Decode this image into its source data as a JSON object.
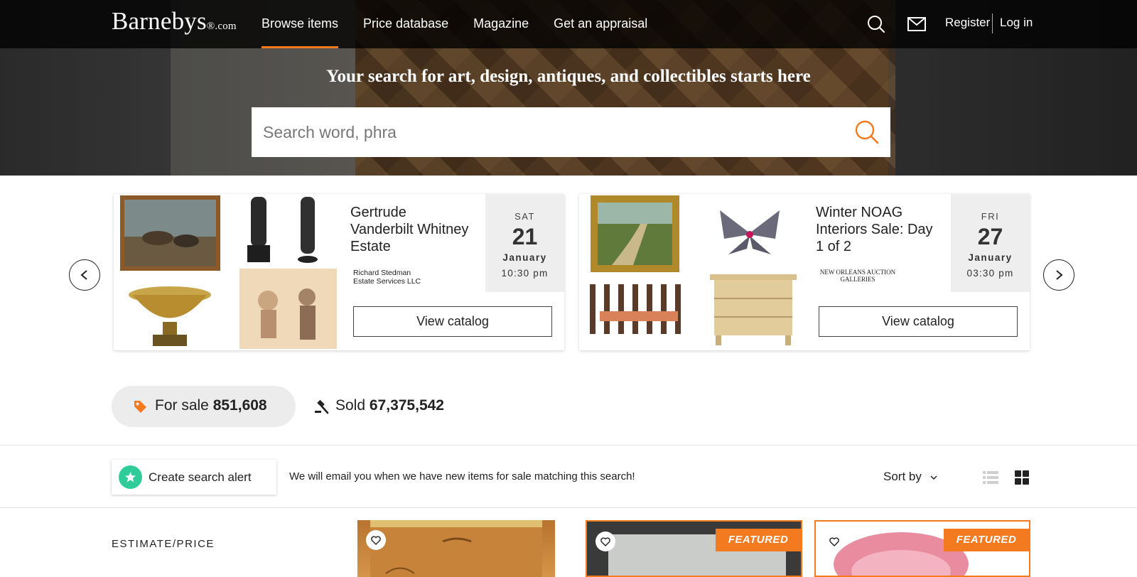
{
  "header": {
    "logo": "Barnebys",
    "logo_suffix": "®.com",
    "nav": [
      {
        "label": "Browse items",
        "active": true
      },
      {
        "label": "Price database",
        "active": false
      },
      {
        "label": "Magazine",
        "active": false
      },
      {
        "label": "Get an appraisal",
        "active": false
      }
    ],
    "icons": [
      "search-icon",
      "mail-icon"
    ],
    "register_label": "Register",
    "login_label": "Log in"
  },
  "hero": {
    "title": "Your search for art, design, antiques, and collectibles starts here",
    "search_placeholder": "Search word, phra"
  },
  "auctions": [
    {
      "title": "Gertrude Vanderbilt Whitney Estate",
      "house_line1": "Richard Stedman",
      "house_line2": "Estate Services LLC",
      "dow": "SAT",
      "day": "21",
      "month": "January",
      "time": "10:30 pm",
      "button": "View catalog"
    },
    {
      "title": "Winter NOAG Interiors Sale: Day 1 of 2",
      "house_line1": "NEW ORLEANS AUCTION",
      "house_line2": "GALLERIES",
      "dow": "FRI",
      "day": "27",
      "month": "January",
      "time": "03:30 pm",
      "button": "View catalog"
    }
  ],
  "counts": {
    "for_sale_label": "For sale",
    "for_sale_value": "851,608",
    "sold_label": "Sold",
    "sold_value": "67,375,542"
  },
  "alert": {
    "button_label": "Create search alert",
    "note": "We will email you when we have new items for sale matching this search!"
  },
  "sort": {
    "label": "Sort by"
  },
  "filters": {
    "heading": "ESTIMATE/PRICE"
  },
  "items": [
    {
      "featured": false
    },
    {
      "featured": true,
      "tag": "FEATURED"
    },
    {
      "featured": true,
      "tag": "FEATURED"
    }
  ],
  "colors": {
    "accent": "#f47a20",
    "alert_green": "#2fcc9a",
    "topbar": "#111111"
  }
}
